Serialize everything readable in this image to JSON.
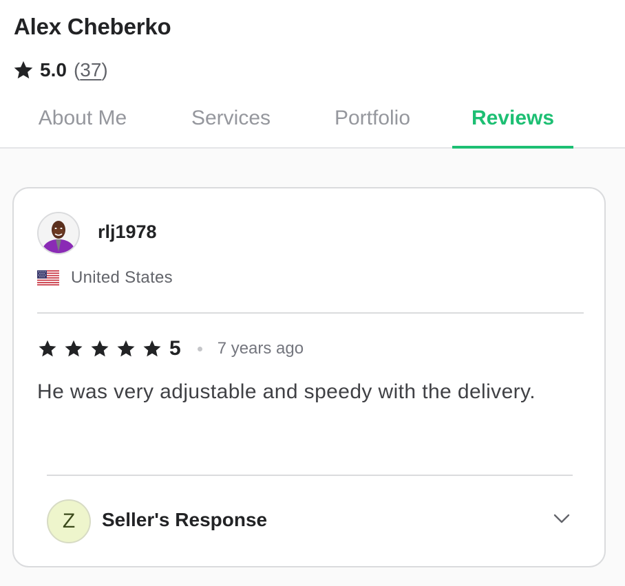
{
  "seller": {
    "name": "Alex Cheberko",
    "rating": "5.0",
    "review_count_open": "(",
    "review_count": "37",
    "review_count_close": ")"
  },
  "tabs": [
    {
      "label": "About Me",
      "active": false
    },
    {
      "label": "Services",
      "active": false
    },
    {
      "label": "Portfolio",
      "active": false
    },
    {
      "label": "Reviews",
      "active": true
    }
  ],
  "review": {
    "username": "rlj1978",
    "country": "United States",
    "stars": 5,
    "rating_label": "5",
    "time_ago": "7 years ago",
    "text": "He was very adjustable and speedy with the delivery.",
    "avatar_icon": "user-avatar"
  },
  "seller_response": {
    "initial": "Z",
    "label": "Seller's Response",
    "expand_icon": "chevron-down-icon"
  },
  "colors": {
    "accent": "#1dbf73",
    "text_primary": "#222325",
    "text_secondary": "#62646a",
    "tab_inactive": "#95979d",
    "star": "#222325",
    "response_avatar_bg": "#eef5cc"
  }
}
